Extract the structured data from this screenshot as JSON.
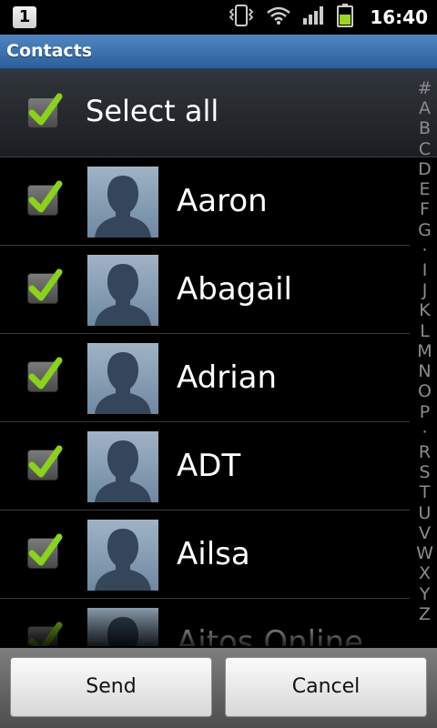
{
  "status_bar": {
    "notification_badge": "1",
    "clock": "16:40",
    "icons": [
      "vibrate-icon",
      "wifi-icon",
      "signal-icon",
      "battery-icon"
    ]
  },
  "title_bar": {
    "title": "Contacts"
  },
  "select_all": {
    "label": "Select all",
    "checked": true
  },
  "contacts": [
    {
      "name": "Aaron",
      "checked": true
    },
    {
      "name": "Abagail",
      "checked": true
    },
    {
      "name": "Adrian",
      "checked": true
    },
    {
      "name": "ADT",
      "checked": true
    },
    {
      "name": "Ailsa",
      "checked": true
    },
    {
      "name": "Aitos Online",
      "checked": true
    }
  ],
  "index_letters": [
    "#",
    "A",
    "B",
    "C",
    "D",
    "E",
    "F",
    "G",
    "·",
    "I",
    "J",
    "K",
    "L",
    "M",
    "N",
    "O",
    "P",
    "·",
    "R",
    "S",
    "T",
    "U",
    "V",
    "W",
    "X",
    "Y",
    "Z"
  ],
  "buttons": {
    "send": "Send",
    "cancel": "Cancel"
  },
  "colors": {
    "title_bar": "#3d73b3",
    "checkmark": "#8ad317",
    "background": "#000000"
  }
}
